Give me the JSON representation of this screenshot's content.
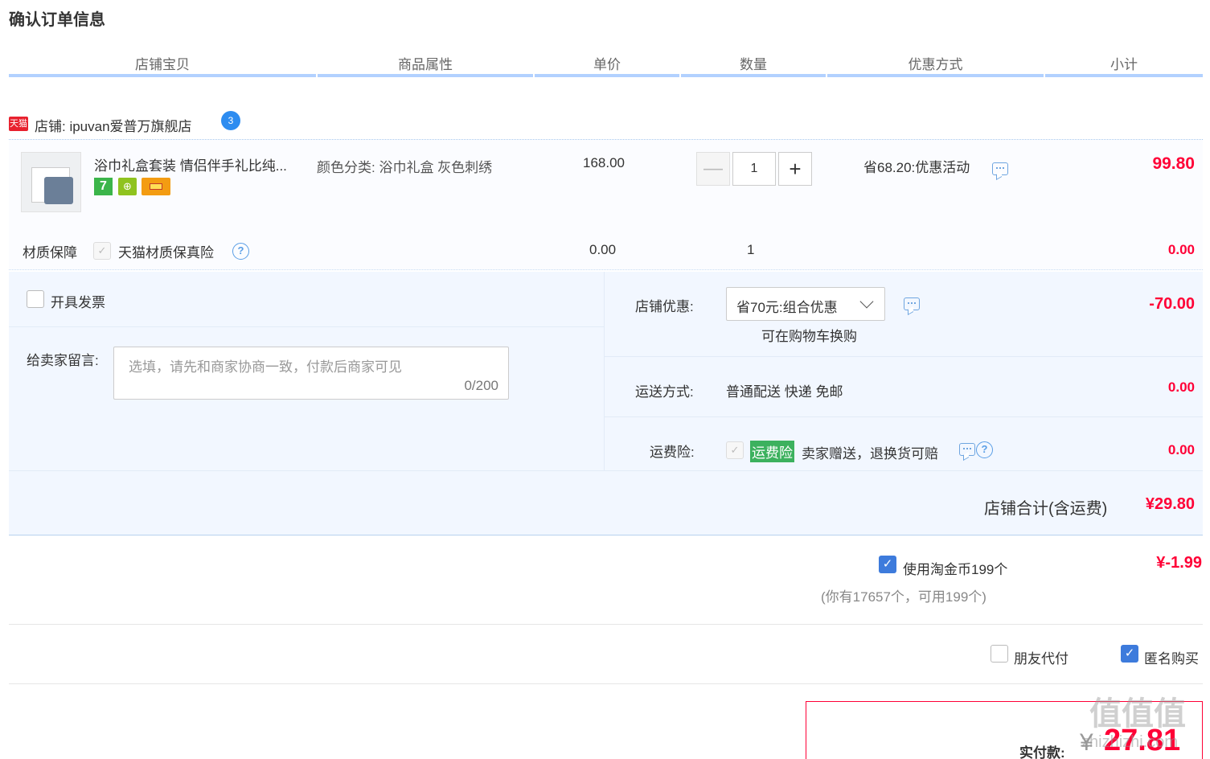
{
  "page": {
    "title": "确认订单信息"
  },
  "columns": [
    "店铺宝贝",
    "商品属性",
    "单价",
    "数量",
    "优惠方式",
    "小计"
  ],
  "shop": {
    "badge": "天猫",
    "label": "店铺: ipuvan爱普万旗舰店"
  },
  "item": {
    "name": "浴巾礼盒套装 情侣伴手礼比纯...",
    "badge_7": "7",
    "attribute": "颜色分类: 浴巾礼盒 灰色刺绣",
    "unit_price": "168.00",
    "quantity": "1",
    "discount": "省68.20:优惠活动",
    "subtotal": "99.80"
  },
  "insurance": {
    "label": "材质保障",
    "name": "天猫材质保真险",
    "price": "0.00",
    "qty": "1",
    "subtotal": "0.00"
  },
  "invoice": {
    "label": "开具发票"
  },
  "message": {
    "label": "给卖家留言:",
    "placeholder": "选填，请先和商家协商一致，付款后商家可见",
    "count": "0/200"
  },
  "shop_discount": {
    "label": "店铺优惠:",
    "selected": "省70元:组合优惠",
    "hint": "可在购物车换购",
    "amount": "-70.00"
  },
  "shipping": {
    "label": "运送方式:",
    "value": "普通配送 快递 免邮",
    "amount": "0.00"
  },
  "return_insurance": {
    "label": "运费险:",
    "badge": "运费险",
    "desc": "卖家赠送，退换货可赔",
    "amount": "0.00"
  },
  "shop_total": {
    "label": "店铺合计(含运费)",
    "amount": "¥29.80"
  },
  "coins": {
    "label": "使用淘金币199个",
    "detail": "(你有17657个，可用199个)",
    "amount": "¥-1.99"
  },
  "options": {
    "friend_pay": "朋友代付",
    "anonymous": "匿名购买"
  },
  "payment": {
    "label": "实付款:",
    "currency": "¥",
    "amount": "27.81"
  },
  "watermark": {
    "logo": "值值值",
    "site": "zhizhizhi.com"
  },
  "icons": {
    "check": "✓",
    "plus": "+",
    "minus": "—",
    "question": "?",
    "wangwang": "3"
  }
}
